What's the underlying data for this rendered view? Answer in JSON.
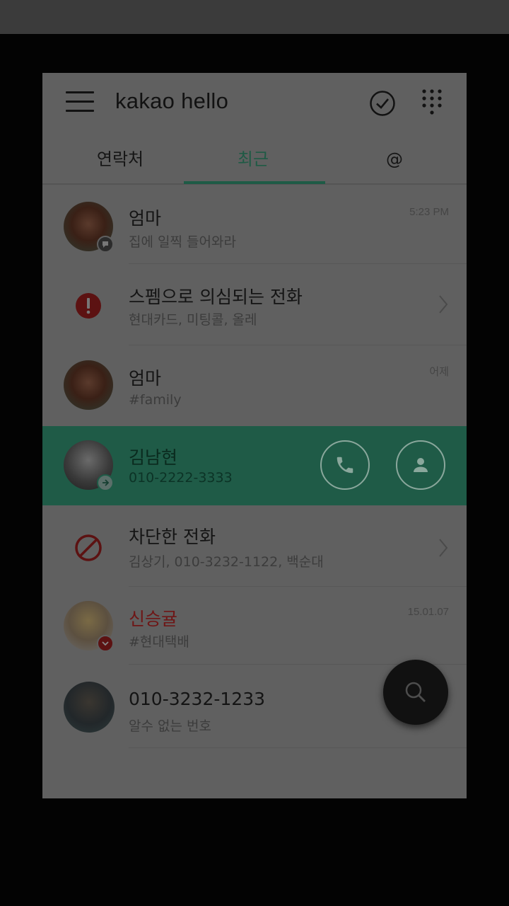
{
  "app": {
    "title": "kakao hello"
  },
  "tabs": [
    {
      "label": "연락처",
      "active": false
    },
    {
      "label": "최근",
      "active": true
    },
    {
      "label": "@",
      "active": false
    }
  ],
  "calls": [
    {
      "name": "엄마",
      "sub": "집에 일찍 들어와라",
      "time": "5:23 PM",
      "badge": "message-icon"
    },
    {
      "name": "스펨으로 의심되는 전화",
      "sub": "현대카드, 미팅콜, 올레",
      "icon": "spam-warning-icon"
    },
    {
      "name": "엄마",
      "sub": "#family",
      "time": "어제"
    },
    {
      "name": "김남현",
      "sub": "010-2222-3333",
      "badge": "outgoing-call-icon",
      "selected": true
    },
    {
      "name": "차단한 전화",
      "sub": "김상기, 010-3232-1122, 백순대",
      "icon": "blocked-icon"
    },
    {
      "name": "신승귤",
      "sub": "#현대택배",
      "time": "15.01.07",
      "badge": "missed-call-icon",
      "name_color": "#6e1616"
    },
    {
      "name": "010-3232-1233",
      "sub": "알수 없는 번호"
    }
  ],
  "colors": {
    "accent": "#1f5b47",
    "missed": "#6e1616",
    "warning": "#5c1212"
  }
}
